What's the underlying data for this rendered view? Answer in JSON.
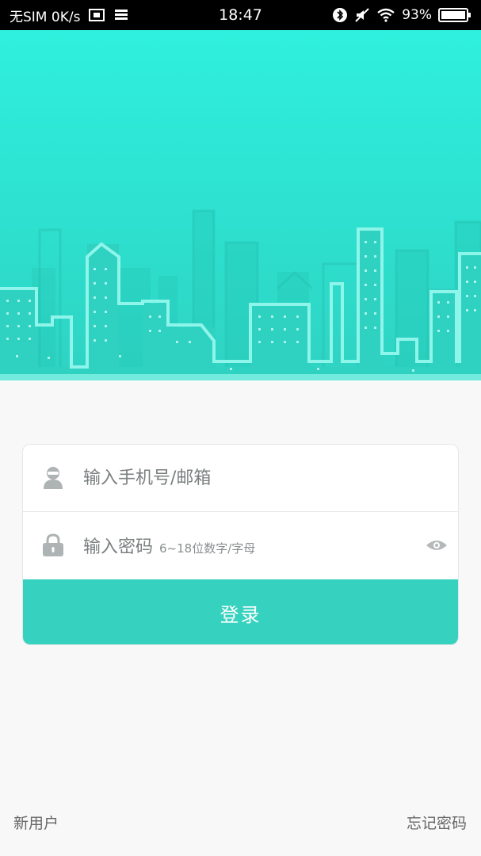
{
  "status_bar": {
    "carrier": "无SIM 0K/s",
    "time": "18:47",
    "battery": "93%",
    "icons": [
      "screenshot-icon",
      "data-icon",
      "bluetooth-icon",
      "mute-icon",
      "wifi-icon",
      "battery-icon"
    ]
  },
  "colors": {
    "banner_top": "#2ff0de",
    "banner_bottom": "#2fd3c2",
    "accent": "#37d2bf"
  },
  "login": {
    "username_placeholder": "输入手机号/邮箱",
    "password_label": "输入密码",
    "password_hint": "6~18位数字/字母",
    "submit_label": "登录"
  },
  "footer": {
    "new_user": "新用户",
    "forgot_password": "忘记密码"
  }
}
